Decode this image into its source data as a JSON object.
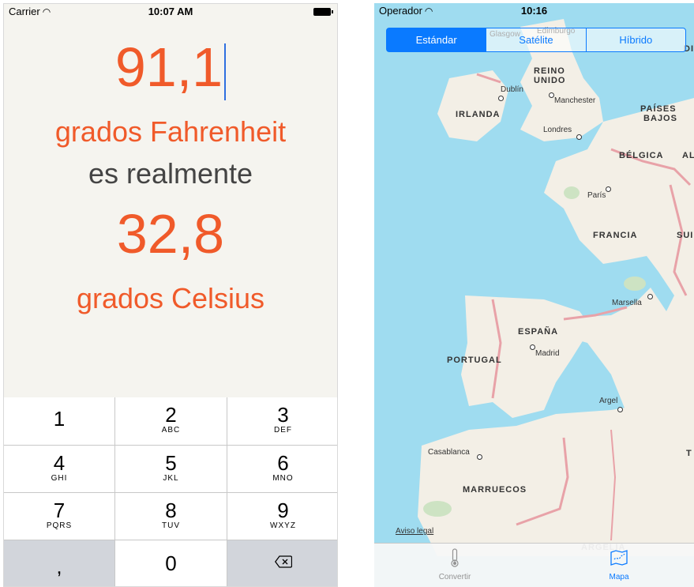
{
  "left_phone": {
    "status": {
      "carrier": "Carrier",
      "time": "10:07 AM"
    },
    "conversion": {
      "input_value": "91,1",
      "input_unit": "grados Fahrenheit",
      "connector": "es realmente",
      "output_value": "32,8",
      "output_unit": "grados Celsius"
    },
    "keypad": {
      "keys": [
        {
          "digit": "1",
          "letters": ""
        },
        {
          "digit": "2",
          "letters": "ABC"
        },
        {
          "digit": "3",
          "letters": "DEF"
        },
        {
          "digit": "4",
          "letters": "GHI"
        },
        {
          "digit": "5",
          "letters": "JKL"
        },
        {
          "digit": "6",
          "letters": "MNO"
        },
        {
          "digit": "7",
          "letters": "PQRS"
        },
        {
          "digit": "8",
          "letters": "TUV"
        },
        {
          "digit": "9",
          "letters": "WXYZ"
        }
      ],
      "decimal": ",",
      "zero": "0"
    },
    "colors": {
      "accent": "#f05a2a",
      "text": "#444444",
      "cursor": "#2f6fe0"
    }
  },
  "right_phone": {
    "status": {
      "carrier": "Operador",
      "time": "10:16"
    },
    "segmented": {
      "options": [
        "Estándar",
        "Satélite",
        "Híbrido"
      ],
      "selected": "Estándar"
    },
    "map": {
      "countries": [
        "REINO UNIDO",
        "IRLANDA",
        "PAÍSES BAJOS",
        "BÉLGICA",
        "AL",
        "FRANCIA",
        "SUI",
        "ESPAÑA",
        "PORTUGAL",
        "MARRUECOS",
        "ARGELIA",
        "DI",
        "T"
      ],
      "cities": [
        "Glasgow",
        "Edimburgo",
        "Dublín",
        "Manchester",
        "Londres",
        "París",
        "Marsella",
        "Madrid",
        "Argel",
        "Casablanca"
      ],
      "legal": "Aviso legal"
    },
    "tabbar": {
      "tabs": [
        {
          "label": "Convertir",
          "icon": "thermometer-icon"
        },
        {
          "label": "Mapa",
          "icon": "map-icon"
        }
      ],
      "selected": "Mapa"
    },
    "colors": {
      "tint": "#0a7aff",
      "water": "#9fdcf0",
      "land": "#f3efe6"
    }
  }
}
